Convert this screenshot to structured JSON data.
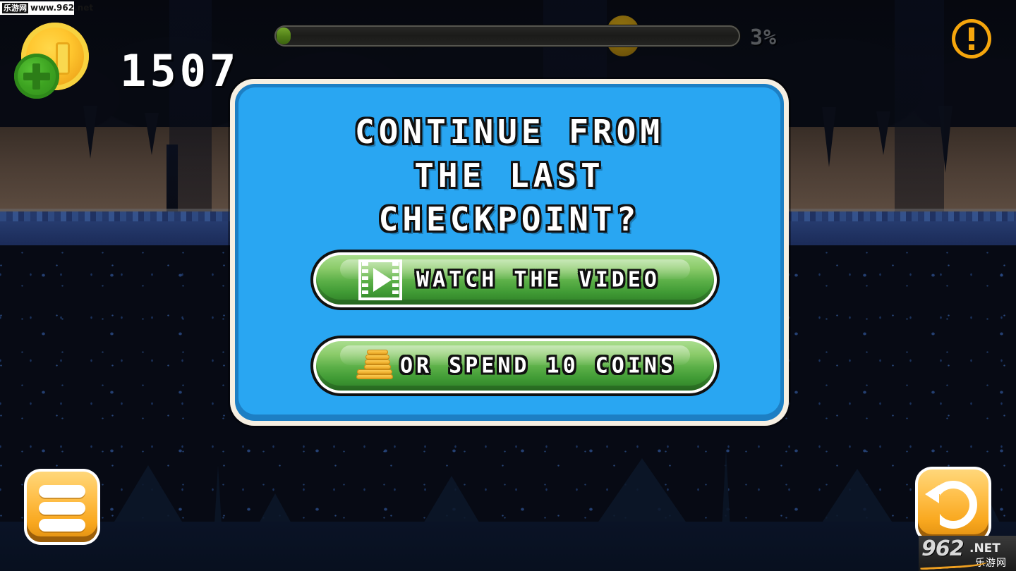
{
  "hud": {
    "coin_icon": "coin-with-plus-icon",
    "coin_count": "1507",
    "progress_percent_label": "3%",
    "progress_value": 3,
    "progress_marker_position_percent": 72,
    "info_icon": "exclamation-circle-icon"
  },
  "dialog": {
    "title_lines": [
      "CONTINUE FROM",
      "THE LAST",
      "CHECKPOINT?"
    ],
    "title_full": "CONTINUE FROM THE LAST CHECKPOINT?",
    "buttons": [
      {
        "id": "watch-video",
        "label": "WATCH  THE  VIDEO",
        "icon": "film-play-icon"
      },
      {
        "id": "spend-coins",
        "label": "OR SPEND 10 COINS",
        "icon": "coin-stack-icon"
      }
    ],
    "colors": {
      "panel_fill": "#29a6f2",
      "panel_inner_border": "#1d7fc4",
      "panel_outer_border": "#f6efe2",
      "button_green_light": "#a9dd8e",
      "button_green_dark": "#2f7e27"
    }
  },
  "controls": {
    "menu_button": {
      "name": "menu-button",
      "icon": "hamburger-menu-icon"
    },
    "restart_button": {
      "name": "restart-button",
      "icon": "restart-arrow-icon"
    }
  },
  "watermarks": {
    "top_cn": "乐游网",
    "top_url": "www.962.net",
    "bottom_number": "962",
    "bottom_net": ".NET",
    "bottom_cn": "乐游网"
  },
  "theme": {
    "accent_yellow": "#f9a81f",
    "accent_orange": "#f5a60d",
    "cave_brown": "#57473c",
    "deep_blue": "#10203f",
    "coin_gold": "#ffc62e"
  }
}
